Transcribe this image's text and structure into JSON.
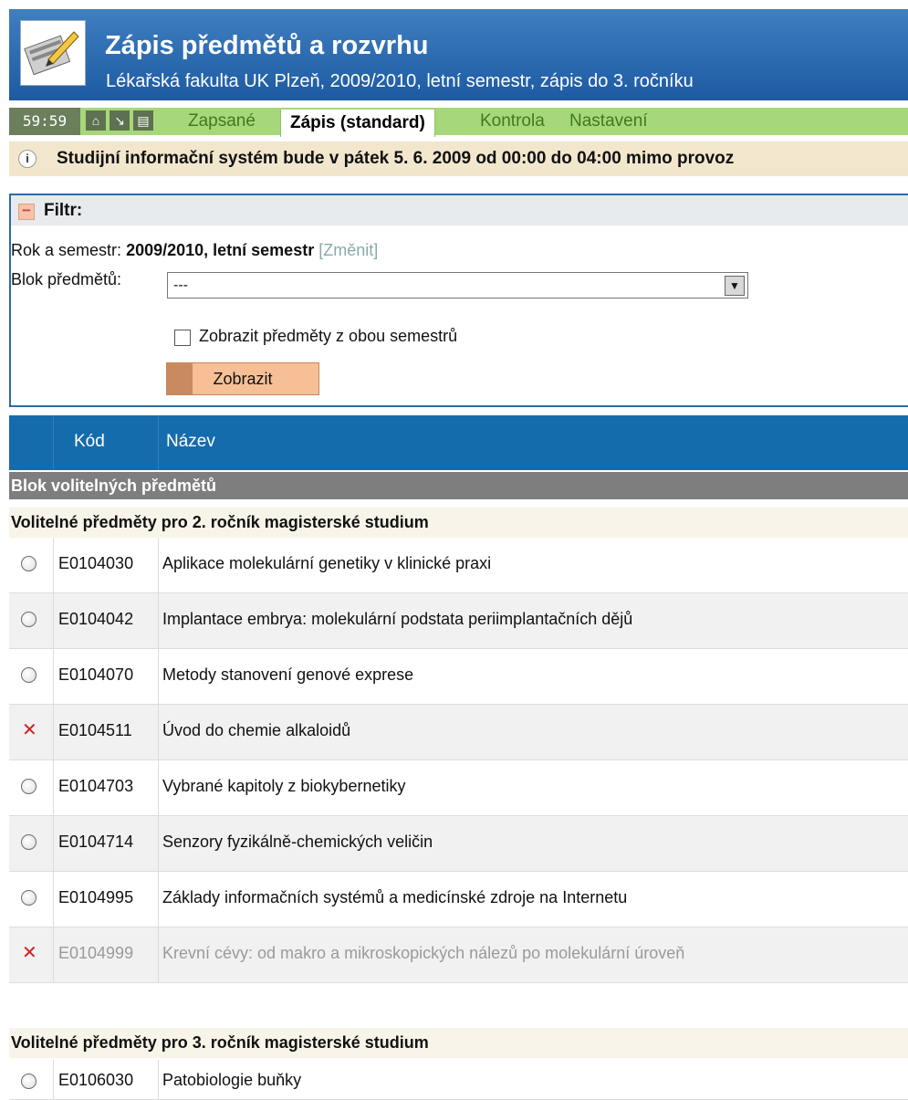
{
  "header": {
    "title": "Zápis předmětů a rozvrhu",
    "subtitle": "Lékařská fakulta UK Plzeň, 2009/2010, letní semestr, zápis do 3. ročníku"
  },
  "nav": {
    "timer": "59:59",
    "tabs": [
      "Zapsané",
      "Zápis (standard)",
      "Kontrola",
      "Nastavení"
    ]
  },
  "notice": {
    "text": "Studijní informační systém bude v pátek 5. 6. 2009 od 00:00 do 04:00 mimo provoz"
  },
  "filter": {
    "title": "Filtr:",
    "semester_label": "Rok a semestr:",
    "semester_value": "2009/2010, letní semestr",
    "change_label": "[Změnit]",
    "block_label": "Blok předmětů:",
    "block_value": "---",
    "checkbox_label": "Zobrazit předměty z obou semestrů",
    "button_label": "Zobrazit"
  },
  "table": {
    "col_code": "Kód",
    "col_name": "Název",
    "block_title": "Blok volitelných předmětů",
    "group1_title": "Volitelné předměty pro 2. ročník magisterské studium",
    "group2_title": "Volitelné předměty pro 3. ročník magisterské studium",
    "rows": [
      {
        "code": "E0104030",
        "name": "Aplikace molekulární genetiky v klinické praxi"
      },
      {
        "code": "E0104042",
        "name": "Implantace embrya: molekulární podstata periimplantačních dějů"
      },
      {
        "code": "E0104070",
        "name": "Metody stanovení genové exprese"
      },
      {
        "code": "E0104511",
        "name": "Úvod do chemie alkaloidů"
      },
      {
        "code": "E0104703",
        "name": "Vybrané kapitoly z biokybernetiky"
      },
      {
        "code": "E0104714",
        "name": "Senzory fyzikálně-chemických veličin"
      },
      {
        "code": "E0104995",
        "name": "Základy informačních systémů a medicínské zdroje na Internetu"
      },
      {
        "code": "E0104999",
        "name": "Krevní cévy: od makro a mikroskopických nálezů po molekulární úroveň"
      },
      {
        "code": "E0106030",
        "name": "Patobiologie buňky"
      }
    ]
  }
}
